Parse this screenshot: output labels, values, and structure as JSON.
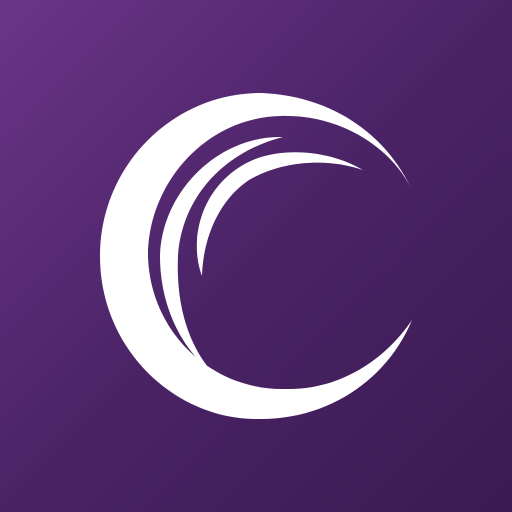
{
  "app_icon": {
    "icon_name": "crescent-c-logo-icon",
    "colors": {
      "background_top": "#6b3587",
      "background_bottom": "#3a1a50",
      "logo": "#ffffff"
    }
  }
}
